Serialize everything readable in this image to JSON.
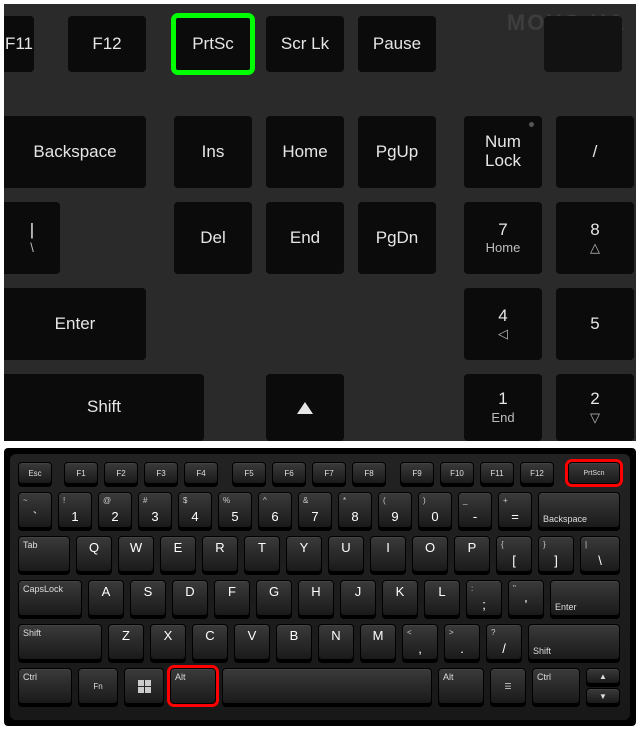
{
  "watermark": "MOYO  UA",
  "top_keyboard": {
    "row_fn": {
      "f11": "F11",
      "f12": "F12",
      "prtsc": "PrtSc",
      "scrlk": "Scr Lk",
      "pause": "Pause"
    },
    "row1": {
      "backspace": "Backspace",
      "ins": "Ins",
      "home": "Home",
      "pgup": "PgUp",
      "numlock": "Num\nLock",
      "div": "/"
    },
    "row2": {
      "pipe": "|",
      "bslash": "\\",
      "del": "Del",
      "end": "End",
      "pgdn": "PgDn",
      "k7": "7",
      "k7_sub": "Home",
      "k8": "8",
      "k8_sub": "△"
    },
    "row3": {
      "enter": "Enter",
      "k4": "4",
      "k4_sub": "◁",
      "k5": "5"
    },
    "row4": {
      "shift": "Shift",
      "k1": "1",
      "k1_sub": "End",
      "k2": "2",
      "k2_sub": "▽"
    }
  },
  "highlight_top": "prtsc",
  "bottom_keyboard": {
    "fn_row": [
      "Esc",
      "F1",
      "F2",
      "F3",
      "F4",
      "F5",
      "F6",
      "F7",
      "F8",
      "F9",
      "F10",
      "F11",
      "F12",
      "PrtScn"
    ],
    "num_row": {
      "tilde": {
        "t": "~",
        "m": "`"
      },
      "1": {
        "t": "!",
        "m": "1"
      },
      "2": {
        "t": "@",
        "m": "2"
      },
      "3": {
        "t": "#",
        "m": "3"
      },
      "4": {
        "t": "$",
        "m": "4"
      },
      "5": {
        "t": "%",
        "m": "5"
      },
      "6": {
        "t": "^",
        "m": "6"
      },
      "7": {
        "t": "&",
        "m": "7"
      },
      "8": {
        "t": "*",
        "m": "8"
      },
      "9": {
        "t": "(",
        "m": "9"
      },
      "0": {
        "t": ")",
        "m": "0"
      },
      "minus": {
        "t": "_",
        "m": "-"
      },
      "eq": {
        "t": "+",
        "m": "="
      },
      "back": "Backspace"
    },
    "q_row": {
      "tab": "Tab",
      "keys": [
        "Q",
        "W",
        "E",
        "R",
        "T",
        "Y",
        "U",
        "I",
        "O",
        "P"
      ],
      "lb": {
        "t": "{",
        "m": "["
      },
      "rb": {
        "t": "}",
        "m": "]"
      },
      "bs": {
        "t": "|",
        "m": "\\"
      }
    },
    "a_row": {
      "caps": "CapsLock",
      "keys": [
        "A",
        "S",
        "D",
        "F",
        "G",
        "H",
        "J",
        "K",
        "L"
      ],
      "semi": {
        "t": ":",
        "m": ";"
      },
      "quote": {
        "t": "\"",
        "m": "'"
      },
      "enter": "Enter"
    },
    "z_row": {
      "lshift": "Shift",
      "keys": [
        "Z",
        "X",
        "C",
        "V",
        "B",
        "N",
        "M"
      ],
      "comma": {
        "t": "<",
        "m": ","
      },
      "dot": {
        "t": ">",
        "m": "."
      },
      "slash": {
        "t": "?",
        "m": "/"
      },
      "rshift": "Shift"
    },
    "mod_row": {
      "ctrl": "Ctrl",
      "fn": "Fn",
      "alt": "Alt",
      "rctrl": "Ctrl"
    }
  },
  "highlight_bottom": [
    "prtscn",
    "alt"
  ]
}
